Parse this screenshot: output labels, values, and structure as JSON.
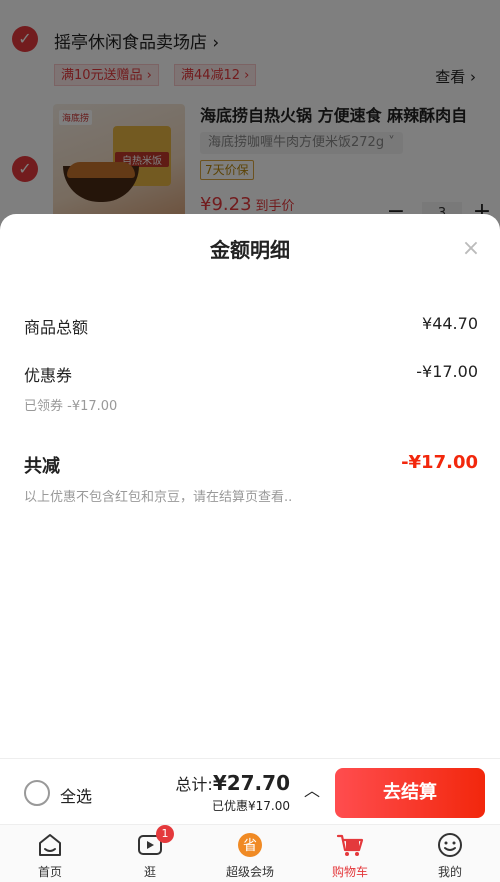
{
  "store": {
    "name": "摇亭休闲食品卖场店 ›",
    "promos": [
      "满10元送赠品 ›",
      "满44减12 ›"
    ],
    "more_label": "查看 ›"
  },
  "item": {
    "title": "海底捞自热火锅 方便速食 麻辣酥肉自",
    "spec": "海底捞咖喱牛肉方便米饭272g ˅",
    "badge": "7天价保",
    "price": "¥9.23",
    "price_note": "到手价",
    "image_brand": "海底捞",
    "image_label": "自热米饭",
    "qty": "3",
    "minus": "−",
    "plus": "+"
  },
  "sheet": {
    "title": "金额明细",
    "close": "×",
    "total_label": "商品总额",
    "total_value": "¥44.70",
    "coupon_label": "优惠券",
    "coupon_value": "-¥17.00",
    "coupon_sub": "已领券 -¥17.00",
    "reduce_label": "共减",
    "reduce_value": "-¥17.00",
    "reduce_note": "以上优惠不包含红包和京豆，请在结算页查看.."
  },
  "checkout": {
    "select_all": "全选",
    "sum_label": "总计:",
    "sum_value": "¥27.70",
    "discount": "已优惠¥17.00",
    "chevron": "︿",
    "button": "去结算"
  },
  "tabs": [
    {
      "label": "首页",
      "icon": "home-icon"
    },
    {
      "label": "逛",
      "icon": "video-icon",
      "badge": "1"
    },
    {
      "label": "超级会场",
      "icon": "super-venue-icon"
    },
    {
      "label": "购物车",
      "icon": "cart-icon",
      "active": true
    },
    {
      "label": "我的",
      "icon": "profile-icon"
    }
  ],
  "colors": {
    "accent": "#e4393c",
    "reduce": "#f2270c",
    "button_start": "#ff4d4f",
    "button_end": "#f2270c"
  }
}
